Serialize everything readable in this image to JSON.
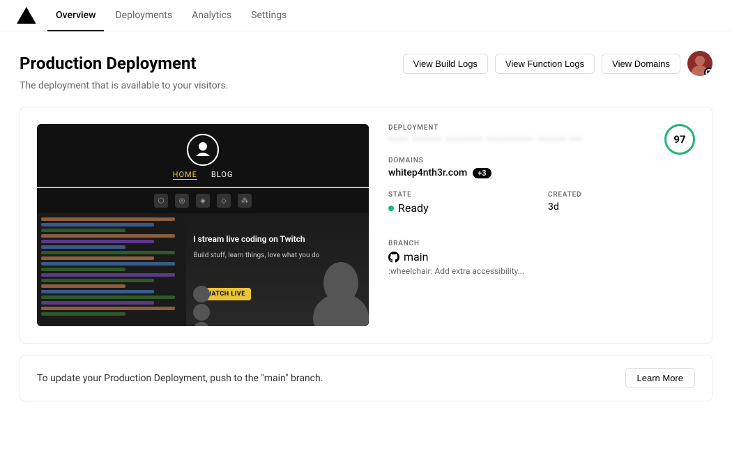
{
  "nav": {
    "logo_alt": "Vercel Logo",
    "tabs": [
      {
        "id": "overview",
        "label": "Overview",
        "active": true
      },
      {
        "id": "deployments",
        "label": "Deployments",
        "active": false
      },
      {
        "id": "analytics",
        "label": "Analytics",
        "active": false
      },
      {
        "id": "settings",
        "label": "Settings",
        "active": false
      }
    ]
  },
  "header": {
    "title": "Production Deployment",
    "subtitle": "The deployment that is available to your visitors.",
    "actions": {
      "view_build_logs": "View Build Logs",
      "view_function_logs": "View Function Logs",
      "view_domains": "View Domains"
    }
  },
  "deployment": {
    "id_blurred": "••••• ••••••• ••••••••• ••••••••••• ••••••• •••",
    "score": "97",
    "domains": {
      "primary": "whitep4nth3r.com",
      "extra_count": "+3"
    },
    "state": {
      "label": "STATE",
      "value": "Ready"
    },
    "created": {
      "label": "CREATED",
      "value": "3d"
    },
    "branch": {
      "label": "BRANCH",
      "name": "main"
    },
    "commit_message": ":wheelchair: Add extra accessibility..."
  },
  "banner": {
    "text": "To update your Production Deployment, push to the \"main\" branch.",
    "learn_more": "Learn More"
  },
  "labels": {
    "deployment": "DEPLOYMENT",
    "domains": "DOMAINS",
    "state": "STATE",
    "created": "CREATED",
    "branch": "BRANCH"
  }
}
